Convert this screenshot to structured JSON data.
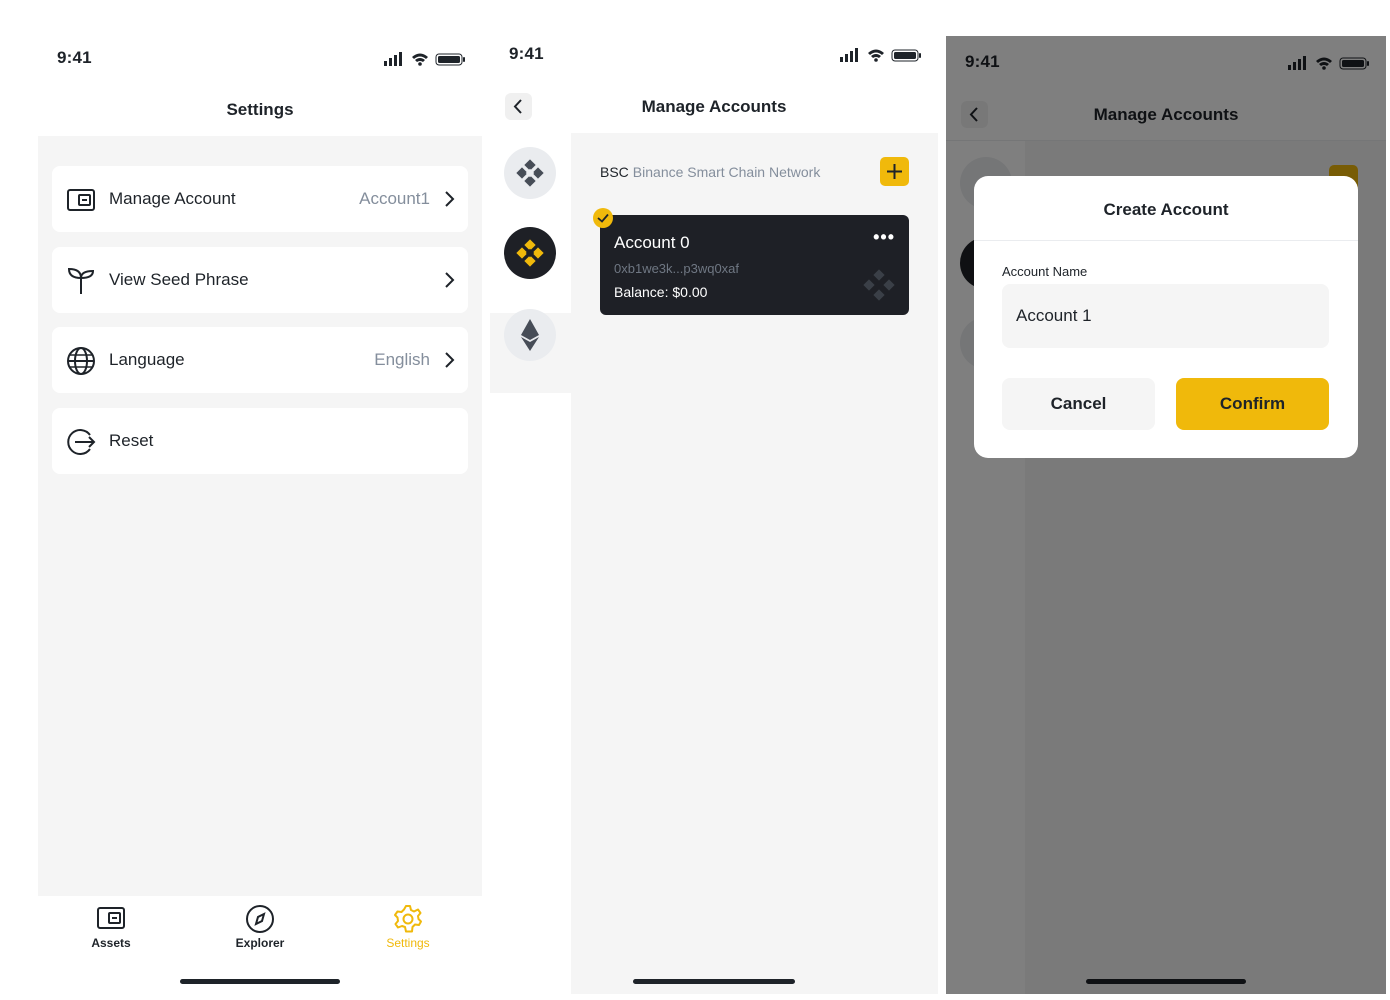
{
  "status_bar": {
    "time": "9:41"
  },
  "settings_screen": {
    "title": "Settings",
    "rows": [
      {
        "label": "Manage Account",
        "value": "Account1",
        "icon": "wallet-icon"
      },
      {
        "label": "View Seed Phrase",
        "value": "",
        "icon": "sprout-icon"
      },
      {
        "label": "Language",
        "value": "English",
        "icon": "globe-icon"
      },
      {
        "label": "Reset",
        "value": "",
        "icon": "logout-icon"
      }
    ],
    "tabs": [
      {
        "label": "Assets",
        "icon": "wallet-icon",
        "active": false
      },
      {
        "label": "Explorer",
        "icon": "compass-icon",
        "active": false
      },
      {
        "label": "Settings",
        "icon": "gear-icon",
        "active": true
      }
    ]
  },
  "manage_accounts_screen": {
    "title": "Manage Accounts",
    "network_code": "BSC",
    "network_name": "Binance Smart Chain Network",
    "chains": [
      "bnb-icon",
      "bsc-icon",
      "ethereum-icon"
    ],
    "account": {
      "name": "Account 0",
      "address": "0xb1we3k...p3wq0xaf",
      "balance": "Balance: $0.00",
      "more": "•••"
    }
  },
  "create_account_modal": {
    "screen_title": "Manage Accounts",
    "title": "Create Account",
    "field_label": "Account Name",
    "field_value": "Account 1",
    "cancel_label": "Cancel",
    "confirm_label": "Confirm"
  },
  "colors": {
    "accent": "#F0B90B",
    "text": "#1E2329",
    "muted": "#848E9C",
    "background": "#F5F5F5",
    "card_dark": "#1E2026"
  }
}
